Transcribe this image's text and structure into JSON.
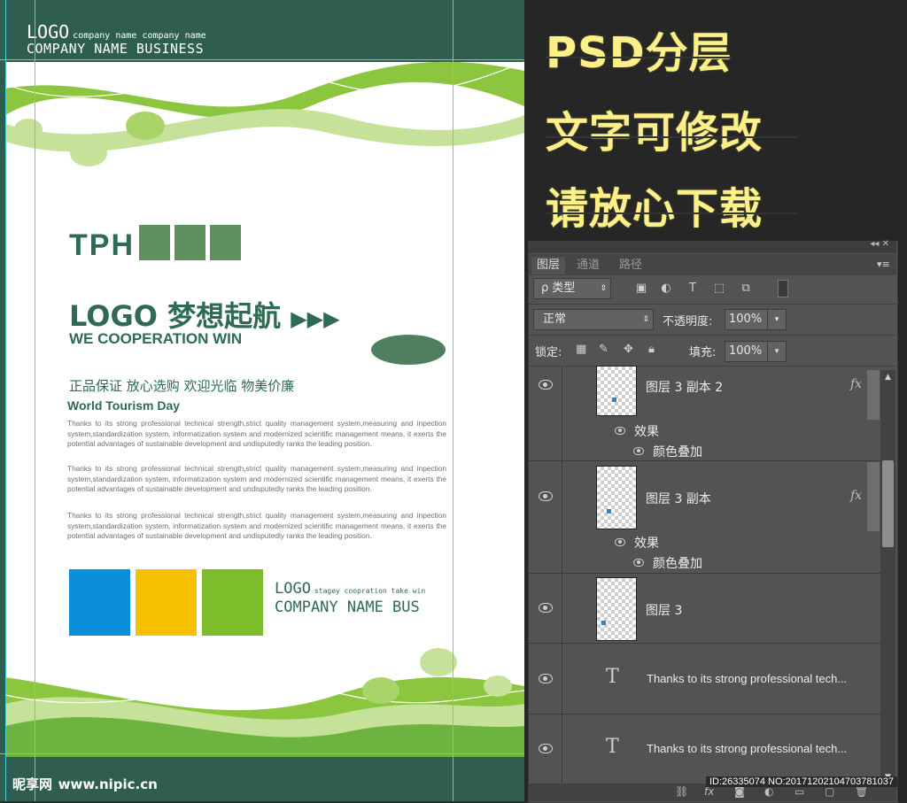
{
  "poster": {
    "top_logo": "LOGO",
    "top_logo_small": "company name company name",
    "top_company": "COMPANY NAME BUSINESS",
    "tph": "TPH",
    "logo_dream": "LOGO 梦想起航",
    "arrows": "▶▶▶",
    "we_coop": "WE COOPERATION WIN",
    "slogan": "正品保证 放心选购 欢迎光临 物美价廉",
    "world_tourism": "World Tourism Day",
    "paragraphs": [
      "Thanks to its strong professional technical strength,strict quality management system,measuring and inpection system,standardization system, informatization system and modernized scientific management means, it exerts the potential advantages of sustainable development and undisputedly ranks the leading position.",
      "Thanks to its strong professional technical strength,strict quality management system,measuring and inpection system,standardization system, informatization system and modernized scientific management means, it exerts the potential advantages of sustainable development and undisputedly ranks the leading position.",
      "Thanks to its strong professional technical strength,strict quality management system,measuring and inpection system,standardization system, informatization system and modernized scientific management means, it exerts the potential advantages of sustainable development and undisputedly ranks the leading position."
    ],
    "bottom_logo": "LOGO",
    "bottom_logo_small": "stagey coopration take win",
    "company_bus": "COMPANY NAME BUS",
    "colors": {
      "blue": "#0a8edb",
      "yellow": "#f8c100",
      "green": "#7dbd2a",
      "dark_green": "#2e6b52"
    }
  },
  "watermark": {
    "brand": "昵享网",
    "url": "www.nipic.cn"
  },
  "promo": {
    "line1": "PSD分层",
    "line2": "文字可修改",
    "line3": "请放心下载"
  },
  "layers_panel": {
    "tabs": [
      "图层",
      "通道",
      "路径"
    ],
    "filter_label": "ρ 类型",
    "blend_mode": "正常",
    "opacity_label": "不透明度:",
    "opacity_value": "100%",
    "lock_label": "锁定:",
    "fill_label": "填充:",
    "fill_value": "100%",
    "layers": [
      {
        "name": "图层 3 副本 2",
        "fx": "fx",
        "effects_label": "效果",
        "effect": "颜色叠加"
      },
      {
        "name": "图层 3 副本",
        "fx": "fx",
        "effects_label": "效果",
        "effect": "颜色叠加"
      },
      {
        "name": "图层 3"
      },
      {
        "type_icon": "T",
        "name": "Thanks to its strong professional tech..."
      },
      {
        "type_icon": "T",
        "name": "Thanks to its strong professional tech..."
      }
    ]
  },
  "id_text": "ID:26335074 NO:20171202104703781037"
}
